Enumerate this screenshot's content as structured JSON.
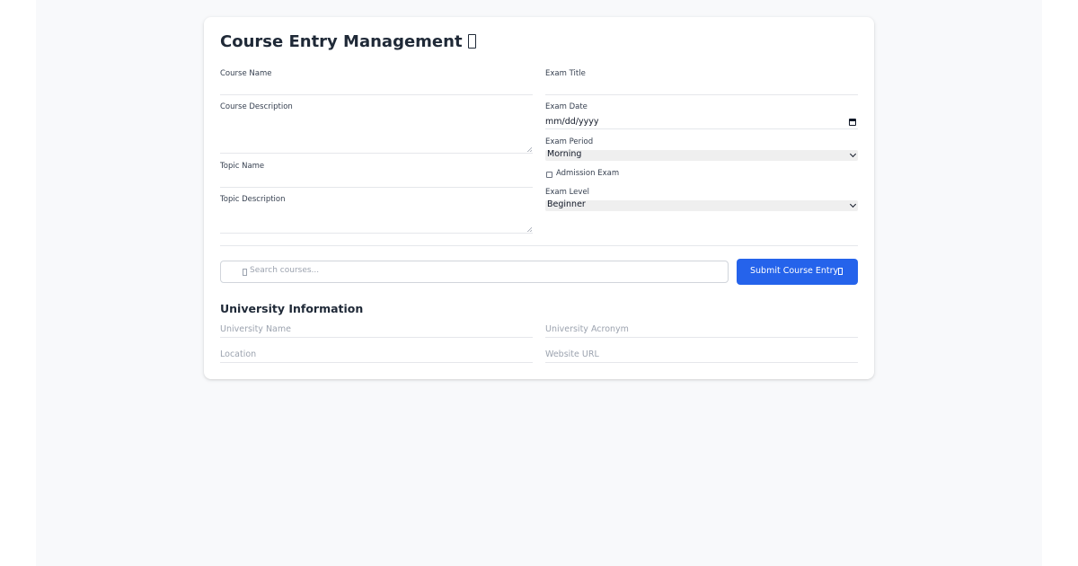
{
  "title": "Course Entry Management",
  "form": {
    "course_name_label": "Course Name",
    "course_description_label": "Course Description",
    "topic_name_label": "Topic Name",
    "topic_description_label": "Topic Description",
    "exam_title_label": "Exam Title",
    "exam_date_label": "Exam Date",
    "exam_date_placeholder": "mm/dd/yyyy",
    "exam_period_label": "Exam Period",
    "exam_period_value": "Morning",
    "admission_exam_label": "Admission Exam",
    "admission_exam_checked": false,
    "exam_level_label": "Exam Level",
    "exam_level_value": "Beginner"
  },
  "search": {
    "placeholder": "Search courses..."
  },
  "submit_label": "Submit Course Entry",
  "university": {
    "heading": "University Information",
    "name_placeholder": "University Name",
    "acronym_placeholder": "University Acronym",
    "location_placeholder": "Location",
    "website_placeholder": "Website URL"
  },
  "colors": {
    "primary": "#2563eb",
    "page_background": "#f8f9fb",
    "card_background": "#ffffff"
  },
  "icons": {
    "title": "missing-glyph-icon",
    "search": "search-icon",
    "submit": "send-icon",
    "exam_date": "calendar-icon",
    "select": "chevron-down-icon"
  }
}
